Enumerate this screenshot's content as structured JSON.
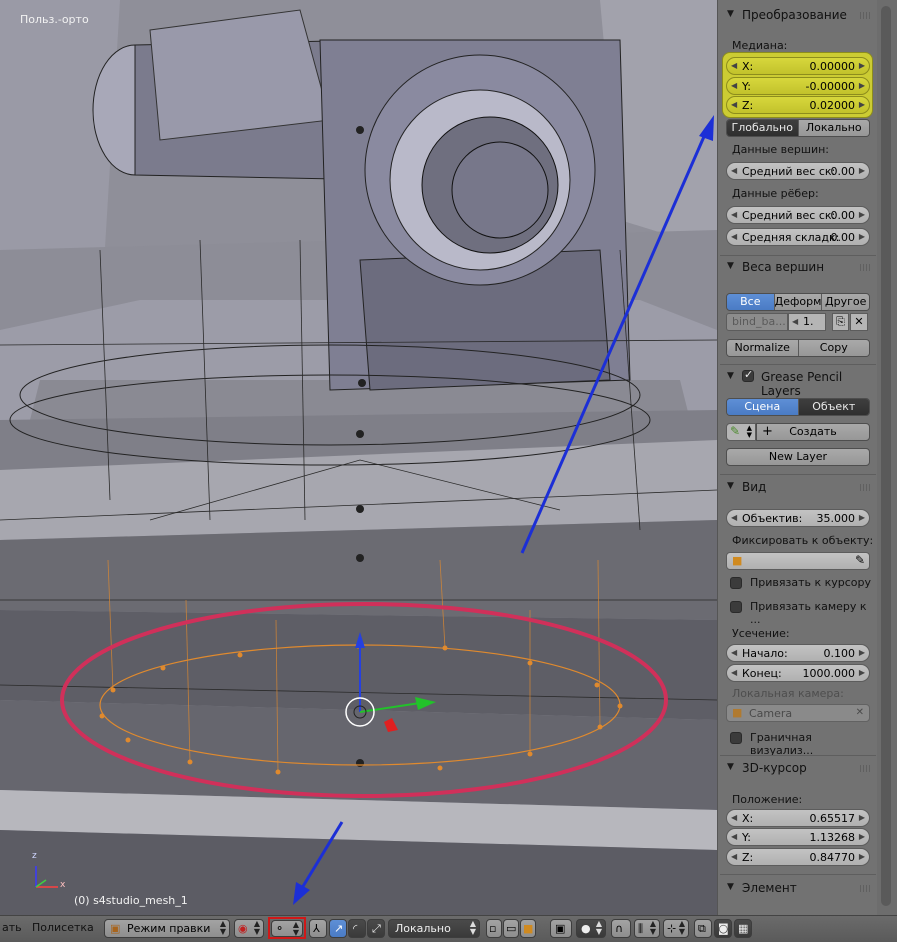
{
  "viewport": {
    "view_label": "Польз.-орто",
    "object_label": "(0) s4studio_mesh_1",
    "axis_z": "z",
    "axis_x": "x"
  },
  "panel": {
    "transform": {
      "header": "Преобразование",
      "median_label": "Медиана:",
      "x_label": "X:",
      "x_value": "0.00000",
      "y_label": "Y:",
      "y_value": "-0.00000",
      "z_label": "Z:",
      "z_value": "0.02000",
      "global_btn": "Глобально",
      "local_btn": "Локально",
      "vertex_data_label": "Данные вершин:",
      "vertex_weight_label": "Средний вес ск:",
      "vertex_weight_value": "0.00",
      "edge_data_label": "Данные рёбер:",
      "edge_weight_label": "Средний вес ск:",
      "edge_weight_value": "0.00",
      "edge_crease_label": "Средняя складк:",
      "edge_crease_value": "0.00"
    },
    "vertex_weights": {
      "header": "Веса вершин",
      "tab_all": "Все",
      "tab_deform": "Деформ",
      "tab_other": "Другое",
      "group_name": "bind_ba...",
      "group_value": "1.",
      "normalize_btn": "Normalize",
      "copy_btn": "Copy"
    },
    "grease_pencil": {
      "header": "Grease Pencil Layers",
      "tab_scene": "Сцена",
      "tab_object": "Объект",
      "create_btn": "Создать",
      "new_layer_btn": "New Layer"
    },
    "view": {
      "header": "Вид",
      "lens_label": "Объектив:",
      "lens_value": "35.000",
      "lock_label": "Фиксировать к объекту:",
      "lock_cursor_label": "Привязать к курсору",
      "lock_camera_label": "Привязать камеру к ...",
      "clip_label": "Усечение:",
      "clip_start_label": "Начало:",
      "clip_start_value": "0.100",
      "clip_end_label": "Конец:",
      "clip_end_value": "1000.000",
      "local_camera_label": "Локальная камера:",
      "camera_value": "Camera",
      "render_border_label": "Граничная визуализ..."
    },
    "cursor3d": {
      "header": "3D-курсор",
      "location_label": "Положение:",
      "x_label": "X:",
      "x_value": "0.65517",
      "y_label": "Y:",
      "y_value": "1.13268",
      "z_label": "Z:",
      "z_value": "0.84770"
    },
    "element": {
      "header": "Элемент"
    }
  },
  "footer": {
    "cut_text": "ать",
    "polysets": "Полисетка",
    "mode": "Режим правки",
    "orientation": "Локально"
  },
  "colors": {
    "highlight_yellow": "#cccc33",
    "annotation_red": "#d0305a",
    "arrow_blue": "#1c2fd6",
    "selection_orange": "#e08a2e",
    "active_blue": "#5680c2"
  }
}
